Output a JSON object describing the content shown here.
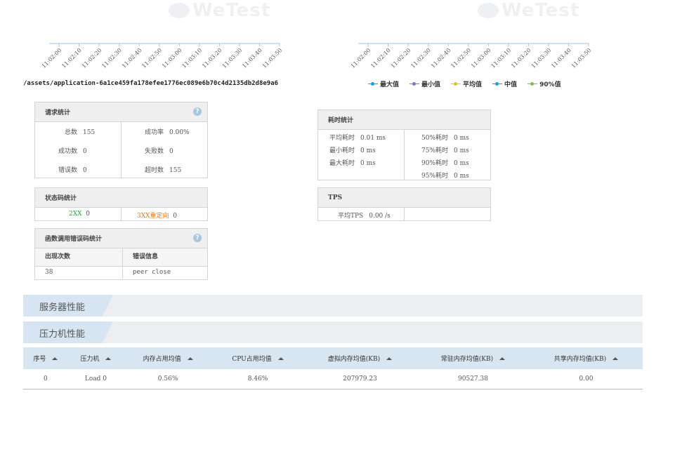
{
  "watermark": "WeTest",
  "left_chart": {
    "x_ticks": [
      "11:02:00",
      "11:02:10",
      "11:02:20",
      "11:02:30",
      "11:02:40",
      "11:02:50",
      "11:03:00",
      "11:03:10",
      "11:03:20",
      "11:03:30",
      "11:03:40",
      "11:03:50"
    ],
    "url": "/assets/application-6a1ce459fa178efee1776ec089e6b70c4d2135db2d8e9a6"
  },
  "right_chart": {
    "x_ticks": [
      "11:02:00",
      "11:02:10",
      "11:02:20",
      "11:02:30",
      "11:02:40",
      "11:02:50",
      "11:03:00",
      "11:03:10",
      "11:03:20",
      "11:03:30",
      "11:03:40",
      "11:03:50"
    ],
    "legend": [
      {
        "label": "最大值",
        "color": "#1a9ee0"
      },
      {
        "label": "最小值",
        "color": "#8e6fc4"
      },
      {
        "label": "平均值",
        "color": "#e0c51a"
      },
      {
        "label": "中值",
        "color": "#1a9ee0"
      },
      {
        "label": "90%值",
        "color": "#7cbd5a"
      }
    ]
  },
  "request_stats": {
    "title": "请求统计",
    "help": "?",
    "rows_left": [
      {
        "key": "总数",
        "val": "155"
      },
      {
        "key": "成功数",
        "val": "0"
      },
      {
        "key": "错误数",
        "val": "0"
      }
    ],
    "rows_right": [
      {
        "key": "成功率",
        "val": "0.00%"
      },
      {
        "key": "失败数",
        "val": "0"
      },
      {
        "key": "超时数",
        "val": "155"
      }
    ]
  },
  "status_stats": {
    "title": "状态码统计",
    "items": [
      {
        "key": "2XX",
        "val": "0",
        "color": "#3a9a3a"
      },
      {
        "key": "3XX重定向",
        "val": "0",
        "color": "#e07a1a"
      }
    ]
  },
  "func_error_stats": {
    "title": "函数调用错误码统计",
    "help": "?",
    "headers": [
      "出现次数",
      "错误信息"
    ],
    "rows": [
      [
        "38",
        "peer close"
      ]
    ]
  },
  "latency_stats": {
    "title": "耗时统计",
    "rows_left": [
      {
        "key": "平均耗时",
        "val": "0.01 ms"
      },
      {
        "key": "最小耗时",
        "val": "0 ms"
      },
      {
        "key": "最大耗时",
        "val": "0 ms"
      }
    ],
    "rows_right": [
      {
        "key": "50%耗时",
        "val": "0 ms"
      },
      {
        "key": "75%耗时",
        "val": "0 ms"
      },
      {
        "key": "90%耗时",
        "val": "0 ms"
      },
      {
        "key": "95%耗时",
        "val": "0 ms"
      }
    ]
  },
  "tps_stats": {
    "title": "TPS",
    "row": {
      "key": "平均TPS",
      "val": "0.00 /s"
    }
  },
  "sections": {
    "server_perf": "服务器性能",
    "loader_perf": "压力机性能"
  },
  "perf_table": {
    "headers": [
      "序号",
      "压力机",
      "内存占用均值",
      "CPU占用均值",
      "虚拟内存均值(KB)",
      "常驻内存均值(KB)",
      "共享内存均值(KB)"
    ],
    "rows": [
      [
        "0",
        "Load 0",
        "0.56%",
        "8.46%",
        "207979.23",
        "90527.38",
        "0.00"
      ]
    ]
  }
}
